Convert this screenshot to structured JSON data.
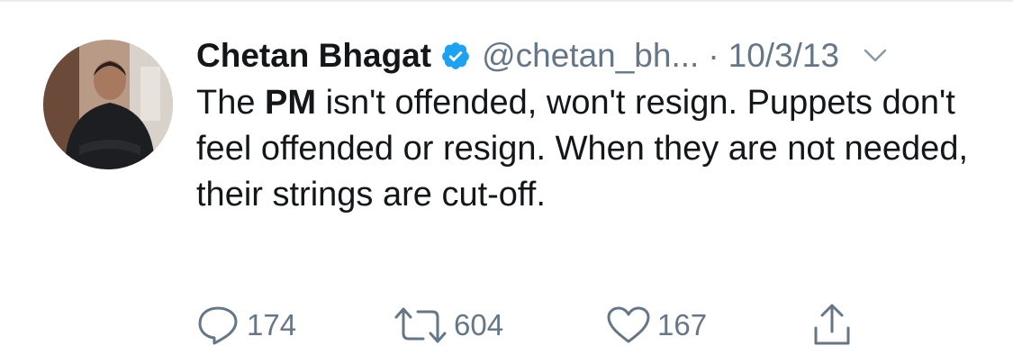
{
  "tweet": {
    "author_name": "Chetan Bhagat",
    "handle": "@chetan_bh...",
    "separator": "·",
    "date": "10/3/13",
    "text": {
      "part1": "The ",
      "bold": "PM",
      "part2": " isn't offended, won't resign. Puppets don't feel offended or resign. When they are not needed, their strings are cut-off."
    },
    "verified": true,
    "avatar_icon": "profile-photo",
    "menu_icon": "chevron-down-icon"
  },
  "actions": {
    "reply": {
      "icon": "reply-icon",
      "count": "174"
    },
    "retweet": {
      "icon": "retweet-icon",
      "count": "604"
    },
    "like": {
      "icon": "heart-icon",
      "count": "167"
    },
    "share": {
      "icon": "share-icon"
    }
  },
  "colors": {
    "text": "#14171a",
    "secondary": "#657786",
    "verified_blue": "#1da1f2"
  }
}
